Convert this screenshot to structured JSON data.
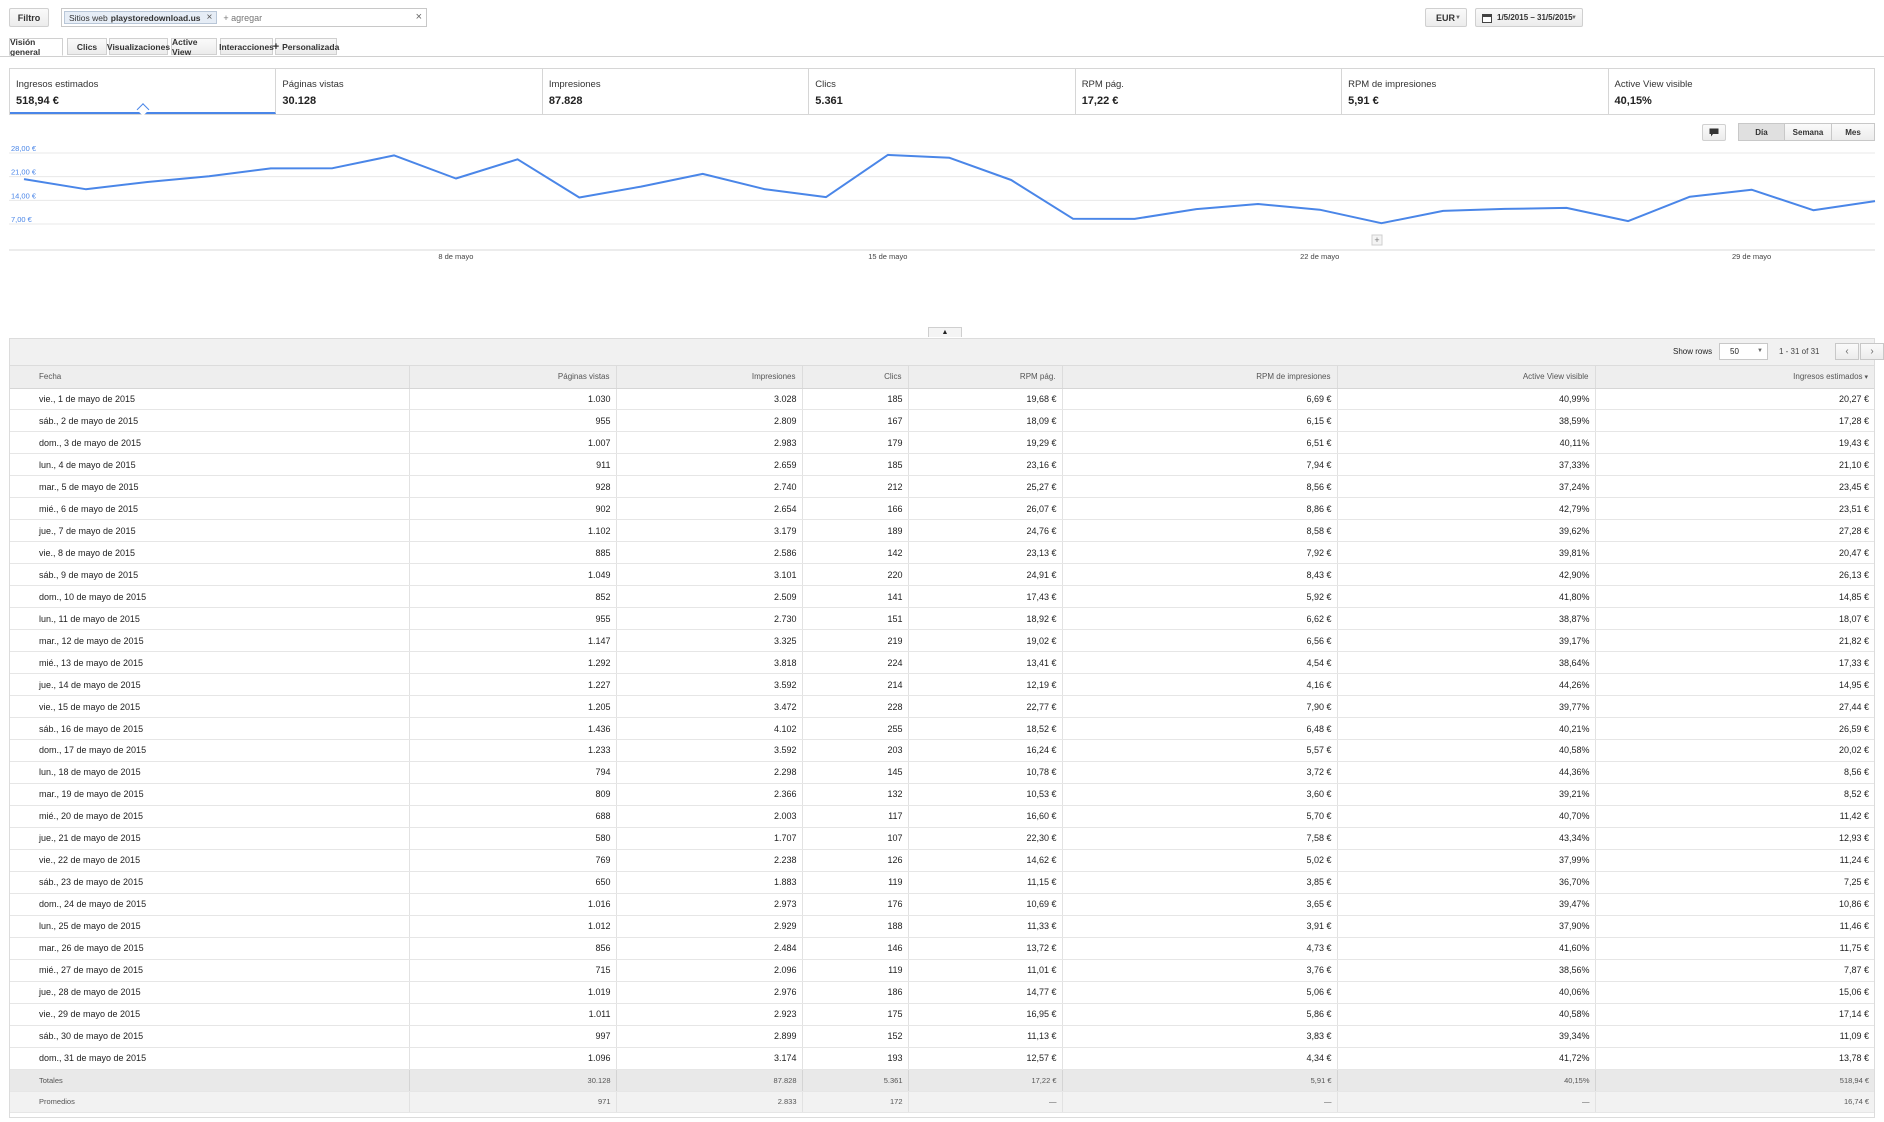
{
  "filter": {
    "button_label": "Filtro",
    "chip_label": "Sitios web",
    "chip_value": "playstoredownload.us",
    "input_placeholder": "+ agregar"
  },
  "currency": "EUR",
  "date_range": "1/5/2015 – 31/5/2015",
  "tabs": [
    "Visión general",
    "Clics",
    "Visualizaciones",
    "Active View",
    "Interacciones",
    "Personalizada"
  ],
  "scorecards": [
    {
      "label": "Ingresos estimados",
      "value": "518,94 €"
    },
    {
      "label": "Páginas vistas",
      "value": "30.128"
    },
    {
      "label": "Impresiones",
      "value": "87.828"
    },
    {
      "label": "Clics",
      "value": "5.361"
    },
    {
      "label": "RPM pág.",
      "value": "17,22 €"
    },
    {
      "label": "RPM de impresiones",
      "value": "5,91 €"
    },
    {
      "label": "Active View visible",
      "value": "40,15%"
    }
  ],
  "period_buttons": [
    "Día",
    "Semana",
    "Mes"
  ],
  "chart_data": {
    "type": "line",
    "x": [
      1,
      2,
      3,
      4,
      5,
      6,
      7,
      8,
      9,
      10,
      11,
      12,
      13,
      14,
      15,
      16,
      17,
      18,
      19,
      20,
      21,
      22,
      23,
      24,
      25,
      26,
      27,
      28,
      29,
      30,
      31
    ],
    "series": [
      {
        "values": [
          20.27,
          17.28,
          19.43,
          21.1,
          23.45,
          23.51,
          27.28,
          20.47,
          26.13,
          14.85,
          18.07,
          21.82,
          17.33,
          14.95,
          27.44,
          26.59,
          20.02,
          8.56,
          8.52,
          11.42,
          12.93,
          11.24,
          7.25,
          10.86,
          11.46,
          11.75,
          7.87,
          15.06,
          17.14,
          11.09,
          13.78
        ]
      }
    ],
    "y_ticks": [
      "28,00 €",
      "21,00 €",
      "14,00 €",
      "7,00 €"
    ],
    "x_ticks": [
      "8 de mayo",
      "15 de mayo",
      "22 de mayo",
      "29 de mayo"
    ],
    "ylim": [
      0,
      30
    ],
    "grid": true,
    "line_color": "#4a86e8"
  },
  "table": {
    "show_rows_label": "Show rows",
    "rows_per_page": "50",
    "range_label": "1 - 31 of 31",
    "headers": [
      "Fecha",
      "Páginas vistas",
      "Impresiones",
      "Clics",
      "RPM pág.",
      "RPM de impresiones",
      "Active View visible",
      "Ingresos estimados"
    ],
    "rows": [
      [
        "vie., 1 de mayo de 2015",
        "1.030",
        "3.028",
        "185",
        "19,68 €",
        "6,69 €",
        "40,99%",
        "20,27 €"
      ],
      [
        "sáb., 2 de mayo de 2015",
        "955",
        "2.809",
        "167",
        "18,09 €",
        "6,15 €",
        "38,59%",
        "17,28 €"
      ],
      [
        "dom., 3 de mayo de 2015",
        "1.007",
        "2.983",
        "179",
        "19,29 €",
        "6,51 €",
        "40,11%",
        "19,43 €"
      ],
      [
        "lun., 4 de mayo de 2015",
        "911",
        "2.659",
        "185",
        "23,16 €",
        "7,94 €",
        "37,33%",
        "21,10 €"
      ],
      [
        "mar., 5 de mayo de 2015",
        "928",
        "2.740",
        "212",
        "25,27 €",
        "8,56 €",
        "37,24%",
        "23,45 €"
      ],
      [
        "mié., 6 de mayo de 2015",
        "902",
        "2.654",
        "166",
        "26,07 €",
        "8,86 €",
        "42,79%",
        "23,51 €"
      ],
      [
        "jue., 7 de mayo de 2015",
        "1.102",
        "3.179",
        "189",
        "24,76 €",
        "8,58 €",
        "39,62%",
        "27,28 €"
      ],
      [
        "vie., 8 de mayo de 2015",
        "885",
        "2.586",
        "142",
        "23,13 €",
        "7,92 €",
        "39,81%",
        "20,47 €"
      ],
      [
        "sáb., 9 de mayo de 2015",
        "1.049",
        "3.101",
        "220",
        "24,91 €",
        "8,43 €",
        "42,90%",
        "26,13 €"
      ],
      [
        "dom., 10 de mayo de 2015",
        "852",
        "2.509",
        "141",
        "17,43 €",
        "5,92 €",
        "41,80%",
        "14,85 €"
      ],
      [
        "lun., 11 de mayo de 2015",
        "955",
        "2.730",
        "151",
        "18,92 €",
        "6,62 €",
        "38,87%",
        "18,07 €"
      ],
      [
        "mar., 12 de mayo de 2015",
        "1.147",
        "3.325",
        "219",
        "19,02 €",
        "6,56 €",
        "39,17%",
        "21,82 €"
      ],
      [
        "mié., 13 de mayo de 2015",
        "1.292",
        "3.818",
        "224",
        "13,41 €",
        "4,54 €",
        "38,64%",
        "17,33 €"
      ],
      [
        "jue., 14 de mayo de 2015",
        "1.227",
        "3.592",
        "214",
        "12,19 €",
        "4,16 €",
        "44,26%",
        "14,95 €"
      ],
      [
        "vie., 15 de mayo de 2015",
        "1.205",
        "3.472",
        "228",
        "22,77 €",
        "7,90 €",
        "39,77%",
        "27,44 €"
      ],
      [
        "sáb., 16 de mayo de 2015",
        "1.436",
        "4.102",
        "255",
        "18,52 €",
        "6,48 €",
        "40,21%",
        "26,59 €"
      ],
      [
        "dom., 17 de mayo de 2015",
        "1.233",
        "3.592",
        "203",
        "16,24 €",
        "5,57 €",
        "40,58%",
        "20,02 €"
      ],
      [
        "lun., 18 de mayo de 2015",
        "794",
        "2.298",
        "145",
        "10,78 €",
        "3,72 €",
        "44,36%",
        "8,56 €"
      ],
      [
        "mar., 19 de mayo de 2015",
        "809",
        "2.366",
        "132",
        "10,53 €",
        "3,60 €",
        "39,21%",
        "8,52 €"
      ],
      [
        "mié., 20 de mayo de 2015",
        "688",
        "2.003",
        "117",
        "16,60 €",
        "5,70 €",
        "40,70%",
        "11,42 €"
      ],
      [
        "jue., 21 de mayo de 2015",
        "580",
        "1.707",
        "107",
        "22,30 €",
        "7,58 €",
        "43,34%",
        "12,93 €"
      ],
      [
        "vie., 22 de mayo de 2015",
        "769",
        "2.238",
        "126",
        "14,62 €",
        "5,02 €",
        "37,99%",
        "11,24 €"
      ],
      [
        "sáb., 23 de mayo de 2015",
        "650",
        "1.883",
        "119",
        "11,15 €",
        "3,85 €",
        "36,70%",
        "7,25 €"
      ],
      [
        "dom., 24 de mayo de 2015",
        "1.016",
        "2.973",
        "176",
        "10,69 €",
        "3,65 €",
        "39,47%",
        "10,86 €"
      ],
      [
        "lun., 25 de mayo de 2015",
        "1.012",
        "2.929",
        "188",
        "11,33 €",
        "3,91 €",
        "37,90%",
        "11,46 €"
      ],
      [
        "mar., 26 de mayo de 2015",
        "856",
        "2.484",
        "146",
        "13,72 €",
        "4,73 €",
        "41,60%",
        "11,75 €"
      ],
      [
        "mié., 27 de mayo de 2015",
        "715",
        "2.096",
        "119",
        "11,01 €",
        "3,76 €",
        "38,56%",
        "7,87 €"
      ],
      [
        "jue., 28 de mayo de 2015",
        "1.019",
        "2.976",
        "186",
        "14,77 €",
        "5,06 €",
        "40,06%",
        "15,06 €"
      ],
      [
        "vie., 29 de mayo de 2015",
        "1.011",
        "2.923",
        "175",
        "16,95 €",
        "5,86 €",
        "40,58%",
        "17,14 €"
      ],
      [
        "sáb., 30 de mayo de 2015",
        "997",
        "2.899",
        "152",
        "11,13 €",
        "3,83 €",
        "39,34%",
        "11,09 €"
      ],
      [
        "dom., 31 de mayo de 2015",
        "1.096",
        "3.174",
        "193",
        "12,57 €",
        "4,34 €",
        "41,72%",
        "13,78 €"
      ]
    ],
    "totals": [
      "Totales",
      "30.128",
      "87.828",
      "5.361",
      "17,22 €",
      "5,91 €",
      "40,15%",
      "518,94 €"
    ],
    "averages": [
      "Promedios",
      "971",
      "2.833",
      "172",
      "—",
      "—",
      "—",
      "16,74 €"
    ]
  },
  "icons": {
    "filter_chip_remove": "close-icon",
    "filter_clear": "close-icon",
    "calendar": "calendar-icon",
    "annotation": "comment-icon",
    "add_annotation": "plus-icon",
    "collapse": "chevron-up-icon",
    "prev_page": "chevron-left-icon",
    "next_page": "chevron-right-icon"
  }
}
